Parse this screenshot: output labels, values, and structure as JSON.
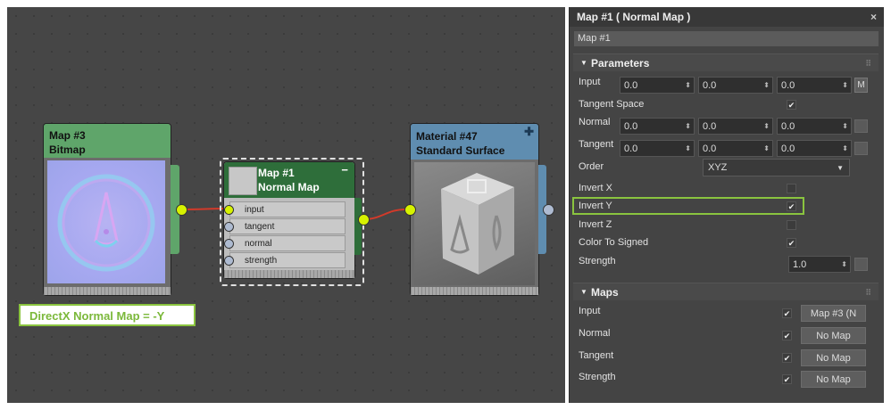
{
  "nodes": {
    "bitmap": {
      "title1": "Map #3",
      "title2": "Bitmap"
    },
    "normalmap": {
      "title1": "Map #1",
      "title2": "Normal Map",
      "slots": [
        "input",
        "tangent",
        "normal",
        "strength"
      ]
    },
    "material": {
      "title1": "Material #47",
      "title2": "Standard Surface"
    }
  },
  "annotation": "DirectX Normal Map = -Y",
  "panel": {
    "title": "Map #1  ( Normal Map )",
    "close": "×",
    "name": "Map #1",
    "params": {
      "header": "Parameters",
      "input_label": "Input",
      "input_values": [
        "0.0",
        "0.0",
        "0.0"
      ],
      "m_button": "M",
      "tangent_space_label": "Tangent Space",
      "normal_label": "Normal",
      "normal_values": [
        "0.0",
        "0.0",
        "0.0"
      ],
      "tangent_label": "Tangent",
      "tangent_values": [
        "0.0",
        "0.0",
        "0.0"
      ],
      "order_label": "Order",
      "order_value": "XYZ",
      "invert_x": "Invert X",
      "invert_y": "Invert Y",
      "invert_z": "Invert Z",
      "color_to_signed": "Color To Signed",
      "strength_label": "Strength",
      "strength_value": "1.0"
    },
    "maps": {
      "header": "Maps",
      "rows": [
        {
          "label": "Input",
          "button": "Map #3 (N"
        },
        {
          "label": "Normal",
          "button": "No Map"
        },
        {
          "label": "Tangent",
          "button": "No Map"
        },
        {
          "label": "Strength",
          "button": "No Map"
        }
      ]
    }
  },
  "colors": {
    "bitmap_header": "#5fa56a",
    "normalmap_header": "#2e6e3a",
    "material_header": "#5f8db0",
    "highlight": "#8ac43f"
  }
}
